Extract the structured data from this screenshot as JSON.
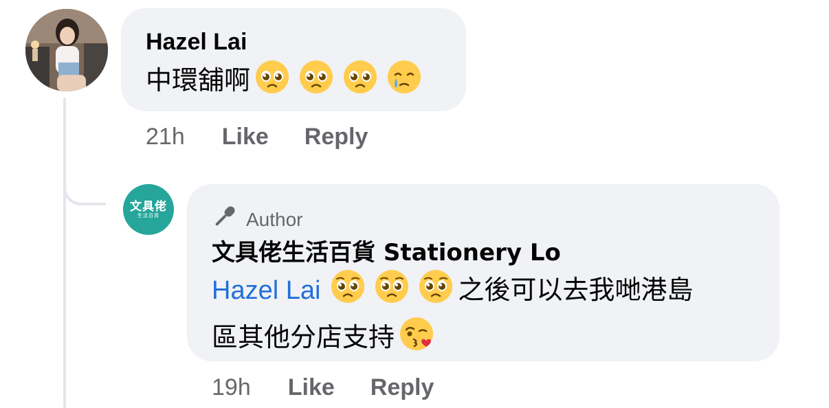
{
  "comment": {
    "author": "Hazel Lai",
    "text": "中環舖啊",
    "emojis": [
      "pleading-face-emoji",
      "pleading-face-emoji",
      "pleading-face-emoji",
      "face-holding-back-tears-emoji"
    ],
    "time": "21h",
    "like_label": "Like",
    "reply_label": "Reply"
  },
  "reply": {
    "badge": "Author",
    "author": "文具佬生活百貨 Stationery Lo",
    "mention": "Hazel Lai",
    "text_line1": "之後可以去我哋港島",
    "text_line2": "區其他分店支持",
    "emojis": [
      "pleading-face-emoji",
      "pleading-face-emoji",
      "pleading-face-emoji",
      "face-blowing-kiss-emoji"
    ],
    "avatar_logo_main": "文具佬",
    "avatar_logo_sub": "生活百貨",
    "time": "19h",
    "like_label": "Like",
    "reply_label": "Reply"
  },
  "colors": {
    "bubble_bg": "#f0f2f5",
    "mention": "#216fdb",
    "meta_text": "#65676b",
    "brand_teal": "#26a69a"
  }
}
